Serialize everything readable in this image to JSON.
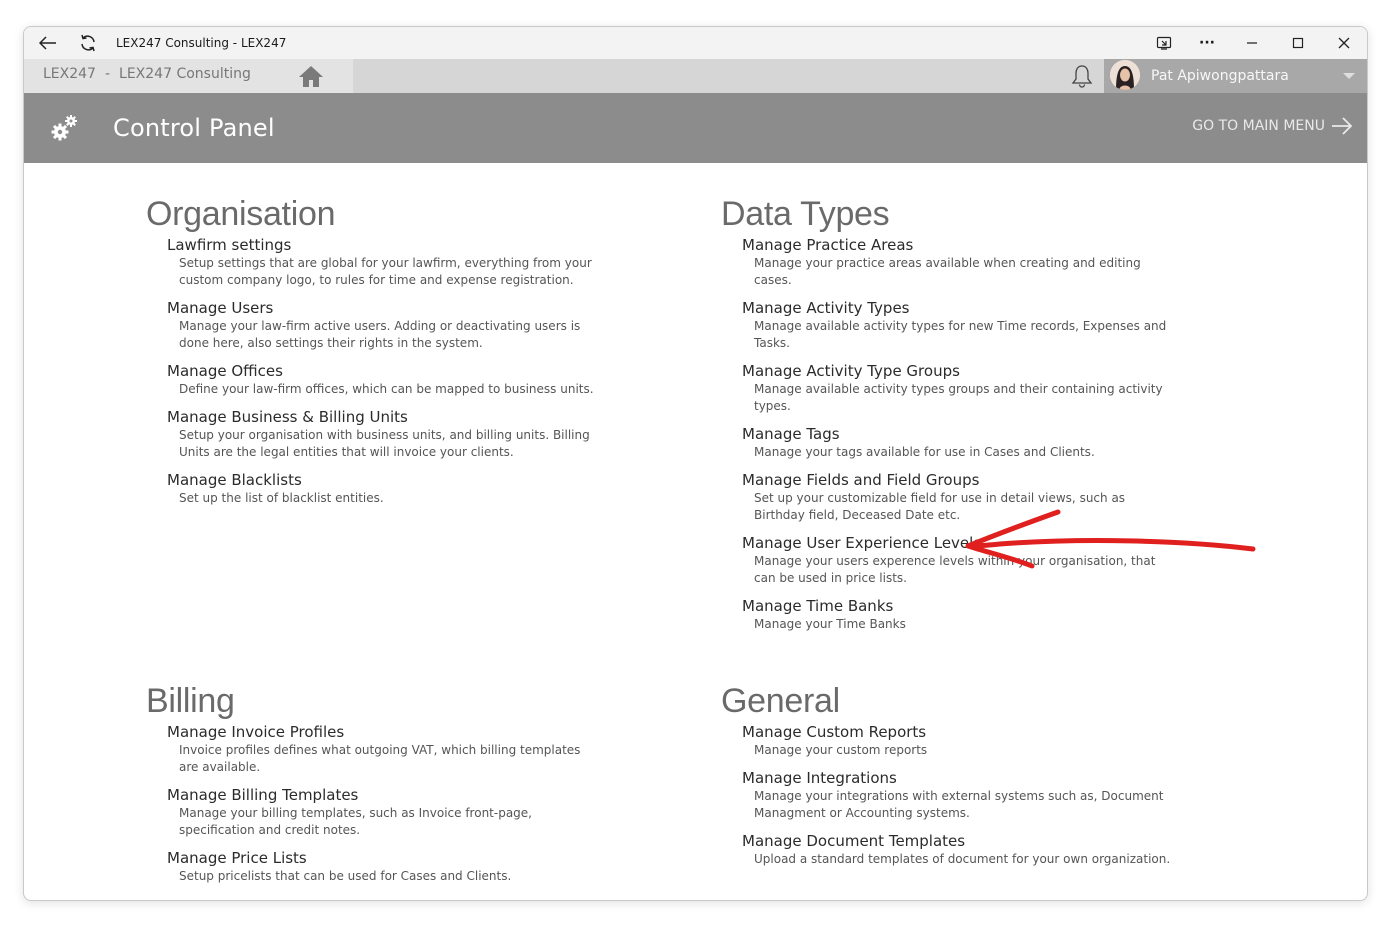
{
  "titlebar": {
    "title": "LEX247 Consulting - LEX247",
    "back_icon": "back-arrow-icon",
    "refresh_icon": "refresh-icon"
  },
  "appbar": {
    "crumb_app": "LEX247",
    "crumb_sep": "-",
    "crumb_firm": "LEX247 Consulting",
    "user_name": "Pat Apiwongpattara"
  },
  "header": {
    "title": "Control Panel",
    "goto_label": "GO TO MAIN MENU"
  },
  "sections": {
    "organisation": {
      "title": "Organisation",
      "items": [
        {
          "label": "Lawfirm settings",
          "desc": "Setup settings that are global for your lawfirm, everything from your custom company logo, to rules for time and expense registration."
        },
        {
          "label": "Manage Users",
          "desc": "Manage your law-firm active users. Adding or deactivating users is done here, also settings their rights in the system."
        },
        {
          "label": "Manage Offices",
          "desc": "Define your law-firm offices, which can be mapped to business units."
        },
        {
          "label": "Manage Business & Billing Units",
          "desc": "Setup your organisation with business units, and billing units. Billing Units are the legal entities that will invoice your clients."
        },
        {
          "label": "Manage Blacklists",
          "desc": "Set up the list of blacklist entities."
        }
      ]
    },
    "data_types": {
      "title": "Data Types",
      "items": [
        {
          "label": "Manage Practice Areas",
          "desc": "Manage your practice areas available when creating and editing cases."
        },
        {
          "label": "Manage Activity Types",
          "desc": "Manage available activity types for new Time records, Expenses and Tasks."
        },
        {
          "label": "Manage Activity Type Groups",
          "desc": "Manage available activity types groups and their containing activity types."
        },
        {
          "label": "Manage Tags",
          "desc": "Manage your tags available for use in Cases and Clients."
        },
        {
          "label": "Manage Fields and Field Groups",
          "desc": "Set up your customizable field for use in detail views, such as Birthday field, Deceased Date etc."
        },
        {
          "label": "Manage User Experience Levels",
          "desc": "Manage your users experence levels within your organisation, that can be used in price lists."
        },
        {
          "label": "Manage Time Banks",
          "desc": "Manage your Time Banks"
        }
      ]
    },
    "billing": {
      "title": "Billing",
      "items": [
        {
          "label": "Manage Invoice Profiles",
          "desc": "Invoice profiles defines what outgoing VAT, which billing templates are available."
        },
        {
          "label": "Manage Billing Templates",
          "desc": "Manage your billing templates, such as Invoice front-page, specification and credit notes."
        },
        {
          "label": "Manage Price Lists",
          "desc": "Setup pricelists that can be used for Cases and Clients."
        }
      ]
    },
    "general": {
      "title": "General",
      "items": [
        {
          "label": "Manage Custom Reports",
          "desc": "Manage your custom reports"
        },
        {
          "label": "Manage Integrations",
          "desc": "Manage your integrations with external systems such as, Document Managment or Accounting systems."
        },
        {
          "label": "Manage Document Templates",
          "desc": "Upload a standard templates of document for your own organization."
        }
      ]
    }
  },
  "colors": {
    "header_bg": "#8c8c8c",
    "appbar_bg": "#d6d6d6",
    "annotation": "#e0201e"
  }
}
